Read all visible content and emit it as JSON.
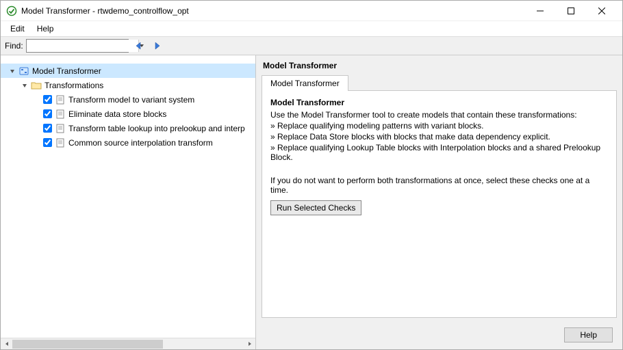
{
  "window": {
    "title": "Model Transformer - rtwdemo_controlflow_opt"
  },
  "menu": {
    "edit": "Edit",
    "help": "Help"
  },
  "toolbar": {
    "find_label": "Find:",
    "find_value": ""
  },
  "tree": {
    "root": {
      "label": "Model Transformer"
    },
    "folder": {
      "label": "Transformations"
    },
    "items": [
      {
        "label": "Transform model to variant system",
        "checked": true
      },
      {
        "label": "Eliminate data store blocks",
        "checked": true
      },
      {
        "label": "Transform table lookup into prelookup and interp",
        "checked": true
      },
      {
        "label": "Common source interpolation transform",
        "checked": true
      }
    ]
  },
  "panel": {
    "title": "Model Transformer",
    "tab_label": "Model Transformer",
    "heading": "Model Transformer",
    "intro": "Use the Model Transformer tool to create models that contain these transformations:",
    "bullets": [
      "» Replace qualifying modeling patterns with variant blocks.",
      "» Replace Data Store blocks with blocks that make data dependency explicit.",
      "» Replace qualifying Lookup Table blocks with Interpolation blocks and a shared Prelookup Block."
    ],
    "note": "If you do not want to perform both transformations at once, select these checks one at a time.",
    "run_button": "Run Selected Checks",
    "help_button": "Help"
  }
}
